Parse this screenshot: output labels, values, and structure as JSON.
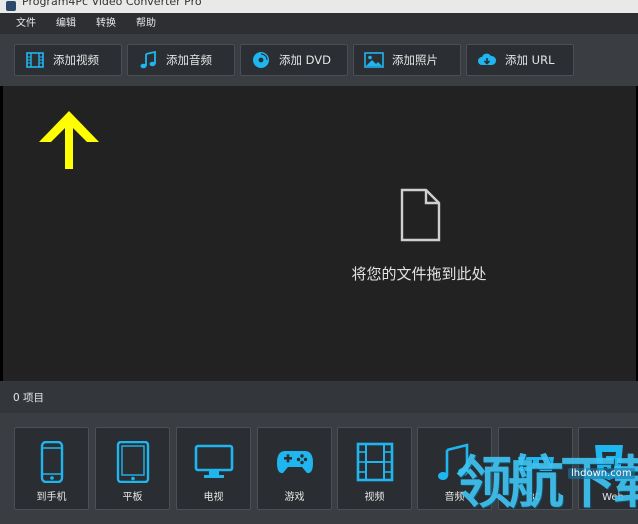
{
  "window": {
    "title": "Program4Pc Video Converter Pro"
  },
  "menu": [
    {
      "label": "文件"
    },
    {
      "label": "编辑"
    },
    {
      "label": "转换"
    },
    {
      "label": "帮助"
    }
  ],
  "toolbar": [
    {
      "label": "添加视频",
      "icon": "film-icon"
    },
    {
      "label": "添加音频",
      "icon": "music-note-icon"
    },
    {
      "label": "添加 DVD",
      "icon": "disc-icon"
    },
    {
      "label": "添加照片",
      "icon": "image-icon"
    },
    {
      "label": "添加 URL",
      "icon": "cloud-download-icon"
    }
  ],
  "dropzone": {
    "text": "将您的文件拖到此处",
    "arrow_color": "#ffff00"
  },
  "status": {
    "count": "0 项目"
  },
  "devices": [
    {
      "label": "到手机",
      "icon": "phone-icon"
    },
    {
      "label": "平板",
      "icon": "tablet-icon"
    },
    {
      "label": "电视",
      "icon": "tv-icon"
    },
    {
      "label": "游戏",
      "icon": "gamepad-icon"
    },
    {
      "label": "视频",
      "icon": "film-icon"
    },
    {
      "label": "音频",
      "icon": "music-notes-icon"
    },
    {
      "label": "3D",
      "icon": "3d-glasses-icon"
    },
    {
      "label": "Web",
      "icon": "html5-icon"
    }
  ],
  "watermark": {
    "text": "领航下载",
    "url": "lhdown.com"
  },
  "colors": {
    "accent": "#1fb6f0",
    "arrow": "#ffff00"
  }
}
